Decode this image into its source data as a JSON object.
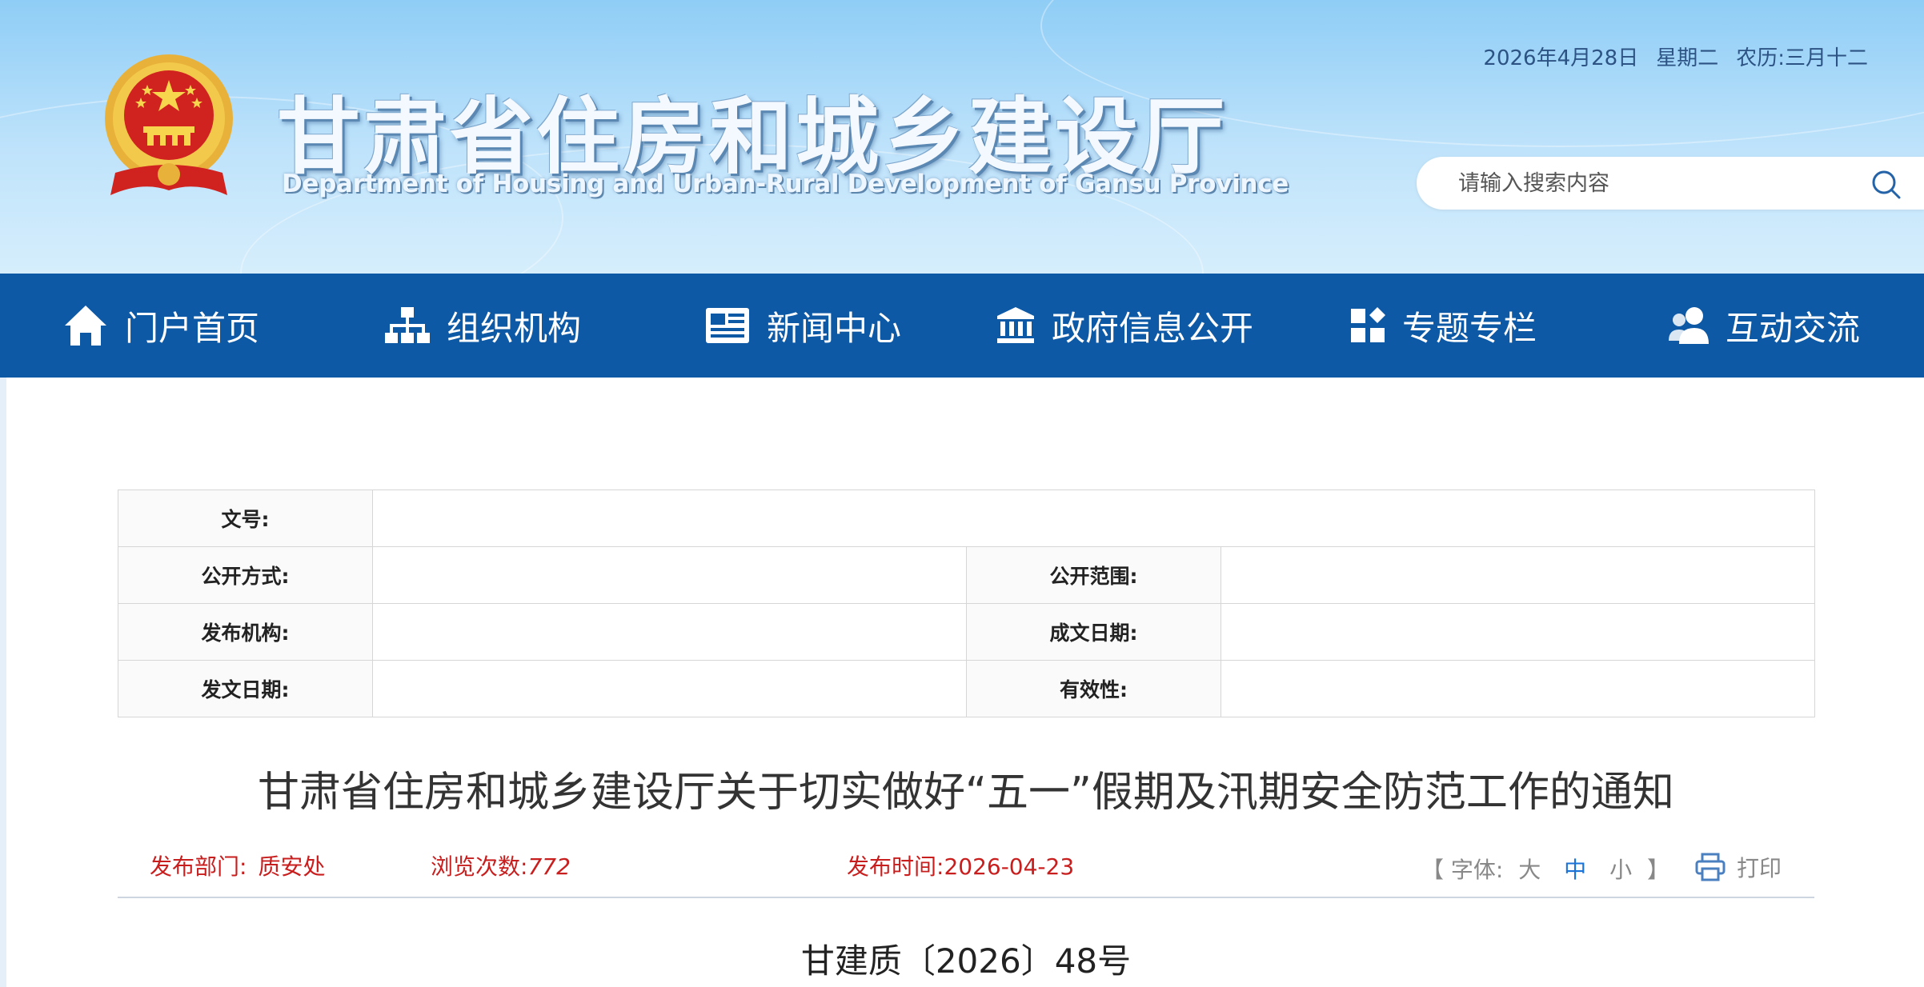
{
  "header": {
    "title_cn": "甘肃省住房和城乡建设厅",
    "title_en": "Department of Housing and Urban-Rural Development of Gansu Province",
    "date": "2026年4月28日",
    "weekday": "星期二",
    "lunar": "农历:三月十二",
    "search_placeholder": "请输入搜索内容"
  },
  "nav": {
    "items": [
      {
        "label": "门户首页",
        "icon": "home-icon"
      },
      {
        "label": "组织机构",
        "icon": "org-chart-icon"
      },
      {
        "label": "新闻中心",
        "icon": "newspaper-icon"
      },
      {
        "label": "政府信息公开",
        "icon": "government-building-icon"
      },
      {
        "label": "专题专栏",
        "icon": "grid-icon"
      },
      {
        "label": "互动交流",
        "icon": "users-icon"
      }
    ]
  },
  "info_table": {
    "doc_number_label": "文号:",
    "disclosure_method_label": "公开方式:",
    "disclosure_scope_label": "公开范围:",
    "issuer_label": "发布机构:",
    "written_date_label": "成文日期:",
    "issue_date_label": "发文日期:",
    "validity_label": "有效性:"
  },
  "article": {
    "title": "甘肃省住房和城乡建设厅关于切实做好“五一”假期及汛期安全防范工作的通知",
    "department_label": "发布部门:",
    "department": "质安处",
    "views_label": "浏览次数:",
    "views": "772",
    "publish_time_label": "发布时间:",
    "publish_time": "2026-04-23",
    "font_label": "【 字体:",
    "font_large": "大",
    "font_medium": "中",
    "font_small": "小",
    "font_close": "】",
    "print_label": "打印",
    "doc_number": "甘建质〔2026〕48号"
  },
  "colors": {
    "nav_bg": "#0d59a6",
    "meta_red": "#c81e1e",
    "active_blue": "#1a73d9"
  }
}
